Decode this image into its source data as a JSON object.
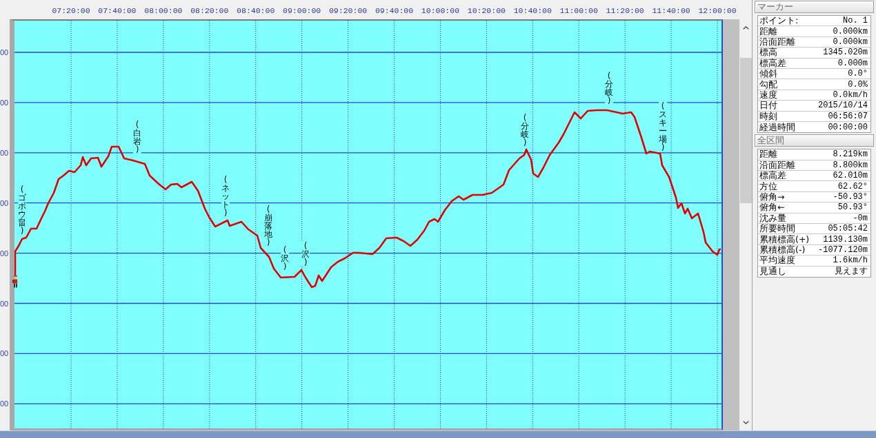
{
  "chart": {
    "time_axis_labels": [
      "07:20:00",
      "07:40:00",
      "08:00:00",
      "08:20:00",
      "08:40:00",
      "09:00:00",
      "09:20:00",
      "09:40:00",
      "10:00:00",
      "10:20:00",
      "10:40:00",
      "11:00:00",
      "11:20:00",
      "11:40:00",
      "12:00:00"
    ],
    "y_axis_labels": [
      "00",
      "00",
      "00",
      "00",
      "00",
      "00",
      "00",
      "00"
    ],
    "waypoint_labels": [
      "(ゴボウ畠)",
      "(白岩)",
      "(ネット)",
      "(崩落地)",
      "(沢)",
      "(沢)",
      "(分岐)",
      "(分岐)",
      "(スキー場)"
    ]
  },
  "marker_panel": {
    "title": "マーカー",
    "rows": [
      {
        "label": "ポイント:",
        "value": "No. 1"
      },
      {
        "label": "距離",
        "value": "0.000km"
      },
      {
        "label": "沿面距離",
        "value": "0.000km"
      },
      {
        "label": "標高",
        "value": "1345.020m"
      },
      {
        "label": "標高差",
        "value": "0.000m"
      },
      {
        "label": "傾斜",
        "value": "0.0°"
      },
      {
        "label": "勾配",
        "value": "0.0%"
      },
      {
        "label": "速度",
        "value": "0.0km/h"
      },
      {
        "label": "日付",
        "value": "2015/10/14"
      },
      {
        "label": "時刻",
        "value": "06:56:07"
      },
      {
        "label": "経過時間",
        "value": "00:00:00"
      }
    ]
  },
  "section_panel": {
    "title": "全区間",
    "rows": [
      {
        "label": "距離",
        "value": "8.219km"
      },
      {
        "label": "沿面距離",
        "value": "8.800km"
      },
      {
        "label": "標高差",
        "value": "62.010m"
      },
      {
        "label": "方位",
        "value": "62.62°"
      },
      {
        "label": "俯角→",
        "value": "-50.93°"
      },
      {
        "label": "俯角←",
        "value": "50.93°"
      },
      {
        "label": "沈み量",
        "value": "-0m"
      },
      {
        "label": "所要時間",
        "value": "05:05:42"
      },
      {
        "label": "累積標高(+)",
        "value": "1139.130m"
      },
      {
        "label": "累積標高(-)",
        "value": "-1077.120m"
      },
      {
        "label": "平均速度",
        "value": "1.6km/h"
      },
      {
        "label": "見通し",
        "value": "見えます"
      }
    ]
  }
}
